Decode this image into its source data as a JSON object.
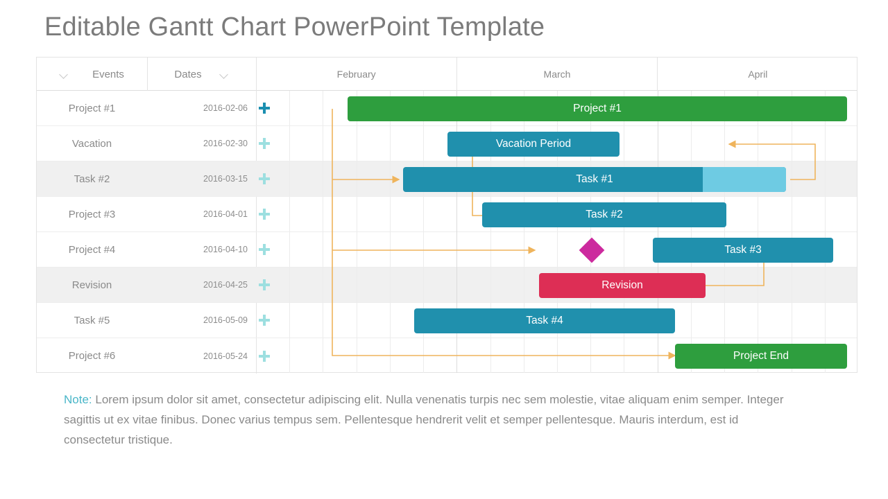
{
  "title": "Editable Gantt Chart PowerPoint Template",
  "table": {
    "headers": {
      "events": "Events",
      "dates": "Dates",
      "events_chevron_icon": "chevron-down-icon",
      "dates_chevron_icon": "chevron-down-icon"
    },
    "months": [
      "February",
      "March",
      "April"
    ],
    "add_icon": "plus-icon",
    "rows": [
      {
        "event": "Project #1",
        "date": "2016-02-06",
        "active": true
      },
      {
        "event": "Vacation",
        "date": "2016-02-30",
        "active": false
      },
      {
        "event": "Task #2",
        "date": "2016-03-15",
        "active": false
      },
      {
        "event": "Project #3",
        "date": "2016-04-01",
        "active": false
      },
      {
        "event": "Project #4",
        "date": "2016-04-10",
        "active": false
      },
      {
        "event": "Revision",
        "date": "2016-04-25",
        "active": false
      },
      {
        "event": "Task #5",
        "date": "2016-05-09",
        "active": false
      },
      {
        "event": "Project #6",
        "date": "2016-05-24",
        "active": false
      }
    ]
  },
  "chart_data": {
    "type": "bar",
    "title": "Editable Gantt Chart PowerPoint Template",
    "categories": [
      "Project #1",
      "Vacation",
      "Task #2",
      "Project #3",
      "Project #4",
      "Revision",
      "Task #5",
      "Project #6"
    ],
    "xlabel": "",
    "ylabel": "",
    "axis_months": [
      "February",
      "March",
      "April"
    ],
    "bars": [
      {
        "row": 0,
        "label": "Project #1",
        "start": 132,
        "end": 852,
        "color": "#2e9e3e",
        "type": "bar"
      },
      {
        "row": 1,
        "label": "Vacation Period",
        "start": 276,
        "end": 524,
        "color": "#2090ad",
        "type": "bar"
      },
      {
        "row": 2,
        "label": "Task #1",
        "start": 212,
        "end": 764,
        "color": "#2090ad",
        "type": "bar",
        "progress_split": 644,
        "progress_color": "#6ecbe3"
      },
      {
        "row": 3,
        "label": "Task #2",
        "start": 326,
        "end": 678,
        "color": "#2090ad",
        "type": "bar"
      },
      {
        "row": 4,
        "label": "Task #3",
        "start": 572,
        "end": 832,
        "color": "#2090ad",
        "type": "bar"
      },
      {
        "row": 4,
        "label": "",
        "start": 484,
        "end": 484,
        "color": "#cc2a9e",
        "type": "milestone"
      },
      {
        "row": 5,
        "label": "Revision",
        "start": 408,
        "end": 648,
        "color": "#dd2e55",
        "type": "bar"
      },
      {
        "row": 6,
        "label": "Task #4",
        "start": 228,
        "end": 604,
        "color": "#2090ad",
        "type": "bar"
      },
      {
        "row": 7,
        "label": "Project End",
        "start": 604,
        "end": 852,
        "color": "#2e9e3e",
        "type": "bar"
      }
    ],
    "colors": {
      "green": "#2e9e3e",
      "teal": "#2090ad",
      "teal_light": "#6ecbe3",
      "crimson": "#dd2e55",
      "magenta": "#cc2a9e",
      "connector": "#efb45c",
      "row_stripe": "#f0f0f0",
      "grid": "#ececec",
      "text_muted": "#8a8a8a",
      "accent": "#49b6c8"
    }
  },
  "note": {
    "lead": "Note:",
    "body": " Lorem ipsum dolor sit amet, consectetur adipiscing elit. Nulla venenatis turpis nec sem molestie, vitae aliquam enim semper. Integer sagittis ut ex vitae finibus. Donec varius tempus sem. Pellentesque hendrerit velit et semper pellentesque. Mauris interdum, est id consectetur tristique."
  }
}
